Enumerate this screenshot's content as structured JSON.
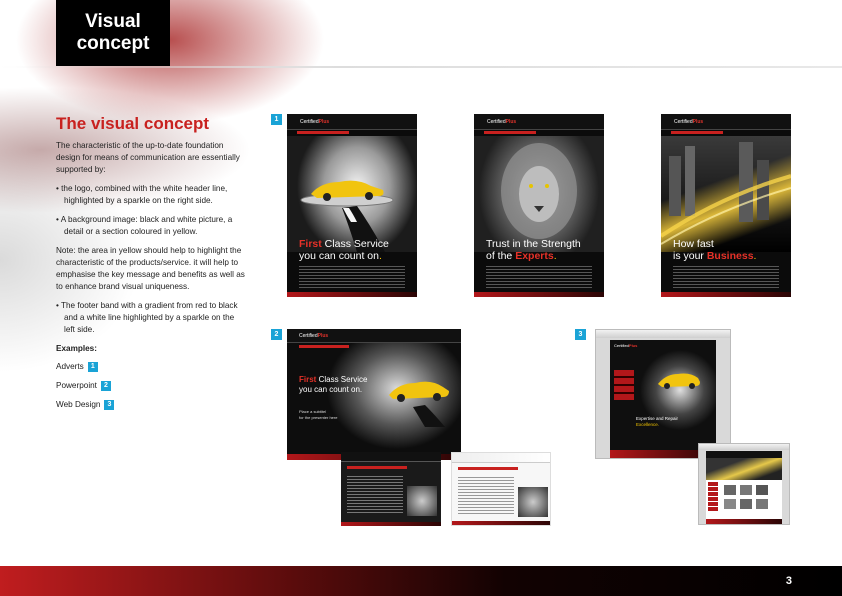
{
  "header": {
    "title_line1": "Visual",
    "title_line2": "concept"
  },
  "left": {
    "heading": "The visual concept",
    "intro": "The characteristic of the up-to-date foundation design for means of communication are essentially supported by:",
    "bullet1": "• the logo, combined with the white header line, highlighted by a sparkle on the right side.",
    "bullet2": "• A background image: black and white picture, a detail or a section coloured in yellow.",
    "note": "Note: the area in yellow should help to highlight the characteristic of the products/service. it will help to emphasise the key message and benefits as well as to enhance brand visual uniqueness.",
    "bullet3": "• The footer band with a gradient from red to black and a white line highlighted by a sparkle on the left side.",
    "examples_title": "Examples:",
    "examples": [
      {
        "label": "Adverts",
        "num": "1"
      },
      {
        "label": "Powerpoint",
        "num": "2"
      },
      {
        "label": "Web Design",
        "num": "3"
      }
    ]
  },
  "badges": {
    "one": "1",
    "two": "2",
    "three": "3"
  },
  "posters": {
    "p1": {
      "red": "First",
      "rest": " Class Service",
      "line2": "you can count on",
      "dot": "."
    },
    "p2": {
      "line1": "Trust in the Strength",
      "line2a": "of the ",
      "red": "Experts",
      "dot": "."
    },
    "p3": {
      "line1": "How fast",
      "line2a": "is your ",
      "red": "Business",
      "dot": "."
    }
  },
  "powerpoint": {
    "red": "First",
    "rest": " Class Service",
    "line2": "you can count on.",
    "sub1": "Place a subtitel",
    "sub2": "for the presenter here"
  },
  "web": {
    "tagline1": "Expertise and Repair",
    "tagline2": "Excellence."
  },
  "footer": {
    "page_number": "3"
  }
}
